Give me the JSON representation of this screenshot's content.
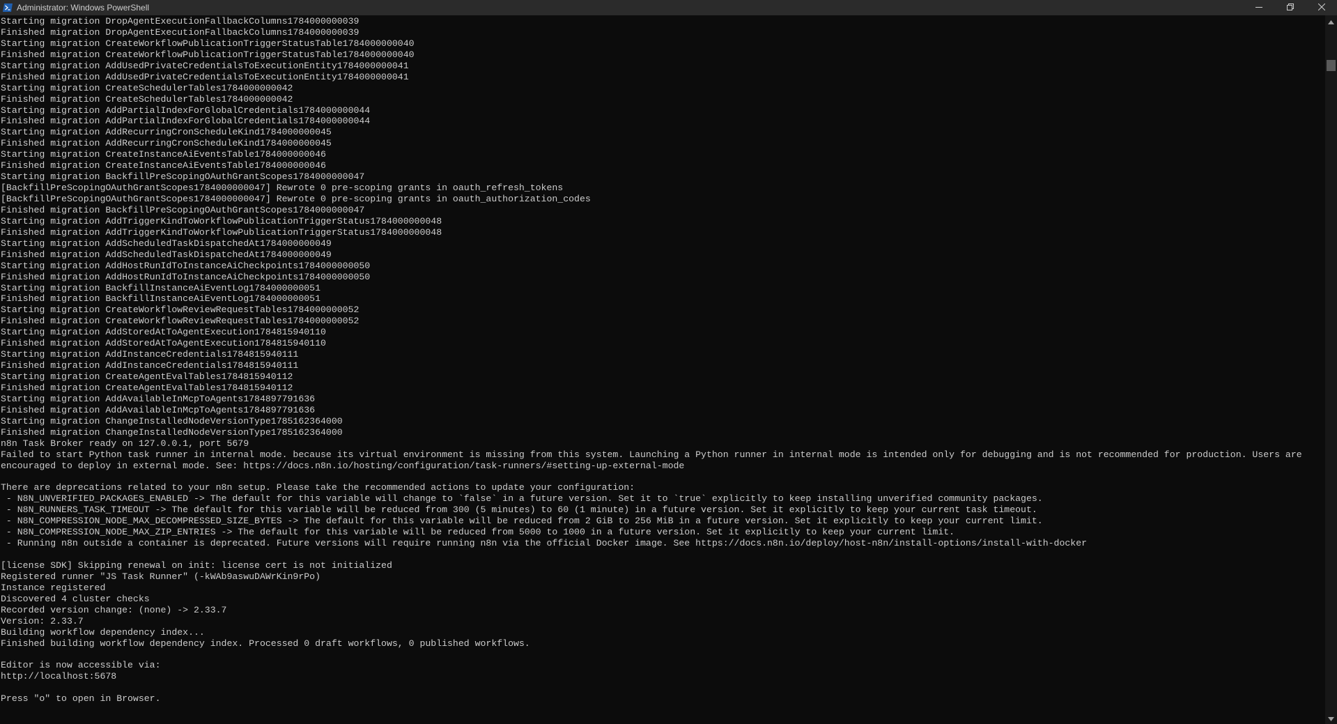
{
  "window": {
    "title": "Administrator: Windows PowerShell",
    "icon": "powershell-icon",
    "controls": [
      "minimize-icon",
      "restore-icon",
      "close-icon"
    ]
  },
  "colors": {
    "background": "#0c0c0c",
    "text": "#cccccc",
    "titlebar": "#2b2b2b",
    "icon_blue": "#1f5fb0"
  },
  "console": {
    "lines": [
      "Starting migration DropAgentExecutionFallbackColumns1784000000039",
      "Finished migration DropAgentExecutionFallbackColumns1784000000039",
      "Starting migration CreateWorkflowPublicationTriggerStatusTable1784000000040",
      "Finished migration CreateWorkflowPublicationTriggerStatusTable1784000000040",
      "Starting migration AddUsedPrivateCredentialsToExecutionEntity1784000000041",
      "Finished migration AddUsedPrivateCredentialsToExecutionEntity1784000000041",
      "Starting migration CreateSchedulerTables1784000000042",
      "Finished migration CreateSchedulerTables1784000000042",
      "Starting migration AddPartialIndexForGlobalCredentials1784000000044",
      "Finished migration AddPartialIndexForGlobalCredentials1784000000044",
      "Starting migration AddRecurringCronScheduleKind1784000000045",
      "Finished migration AddRecurringCronScheduleKind1784000000045",
      "Starting migration CreateInstanceAiEventsTable1784000000046",
      "Finished migration CreateInstanceAiEventsTable1784000000046",
      "Starting migration BackfillPreScopingOAuthGrantScopes1784000000047",
      "[BackfillPreScopingOAuthGrantScopes1784000000047] Rewrote 0 pre-scoping grants in oauth_refresh_tokens",
      "[BackfillPreScopingOAuthGrantScopes1784000000047] Rewrote 0 pre-scoping grants in oauth_authorization_codes",
      "Finished migration BackfillPreScopingOAuthGrantScopes1784000000047",
      "Starting migration AddTriggerKindToWorkflowPublicationTriggerStatus1784000000048",
      "Finished migration AddTriggerKindToWorkflowPublicationTriggerStatus1784000000048",
      "Starting migration AddScheduledTaskDispatchedAt1784000000049",
      "Finished migration AddScheduledTaskDispatchedAt1784000000049",
      "Starting migration AddHostRunIdToInstanceAiCheckpoints1784000000050",
      "Finished migration AddHostRunIdToInstanceAiCheckpoints1784000000050",
      "Starting migration BackfillInstanceAiEventLog1784000000051",
      "Finished migration BackfillInstanceAiEventLog1784000000051",
      "Starting migration CreateWorkflowReviewRequestTables1784000000052",
      "Finished migration CreateWorkflowReviewRequestTables1784000000052",
      "Starting migration AddStoredAtToAgentExecution1784815940110",
      "Finished migration AddStoredAtToAgentExecution1784815940110",
      "Starting migration AddInstanceCredentials1784815940111",
      "Finished migration AddInstanceCredentials1784815940111",
      "Starting migration CreateAgentEvalTables1784815940112",
      "Finished migration CreateAgentEvalTables1784815940112",
      "Starting migration AddAvailableInMcpToAgents1784897791636",
      "Finished migration AddAvailableInMcpToAgents1784897791636",
      "Starting migration ChangeInstalledNodeVersionType1785162364000",
      "Finished migration ChangeInstalledNodeVersionType1785162364000",
      "n8n Task Broker ready on 127.0.0.1, port 5679",
      "Failed to start Python task runner in internal mode. because its virtual environment is missing from this system. Launching a Python runner in internal mode is intended only for debugging and is not recommended for production. Users are",
      "encouraged to deploy in external mode. See: https://docs.n8n.io/hosting/configuration/task-runners/#setting-up-external-mode",
      "",
      "There are deprecations related to your n8n setup. Please take the recommended actions to update your configuration:",
      " - N8N_UNVERIFIED_PACKAGES_ENABLED -> The default for this variable will change to `false` in a future version. Set it to `true` explicitly to keep installing unverified community packages.",
      " - N8N_RUNNERS_TASK_TIMEOUT -> The default for this variable will be reduced from 300 (5 minutes) to 60 (1 minute) in a future version. Set it explicitly to keep your current task timeout.",
      " - N8N_COMPRESSION_NODE_MAX_DECOMPRESSED_SIZE_BYTES -> The default for this variable will be reduced from 2 GiB to 256 MiB in a future version. Set it explicitly to keep your current limit.",
      " - N8N_COMPRESSION_NODE_MAX_ZIP_ENTRIES -> The default for this variable will be reduced from 5000 to 1000 in a future version. Set it explicitly to keep your current limit.",
      " - Running n8n outside a container is deprecated. Future versions will require running n8n via the official Docker image. See https://docs.n8n.io/deploy/host-n8n/install-options/install-with-docker",
      "",
      "[license SDK] Skipping renewal on init: license cert is not initialized",
      "Registered runner \"JS Task Runner\" (-kWAb9aswuDAWrKin9rPo)",
      "Instance registered",
      "Discovered 4 cluster checks",
      "Recorded version change: (none) -> 2.33.7",
      "Version: 2.33.7",
      "Building workflow dependency index...",
      "Finished building workflow dependency index. Processed 0 draft workflows, 0 published workflows.",
      "",
      "Editor is now accessible via:",
      "http://localhost:5678",
      "",
      "Press \"o\" to open in Browser."
    ]
  }
}
